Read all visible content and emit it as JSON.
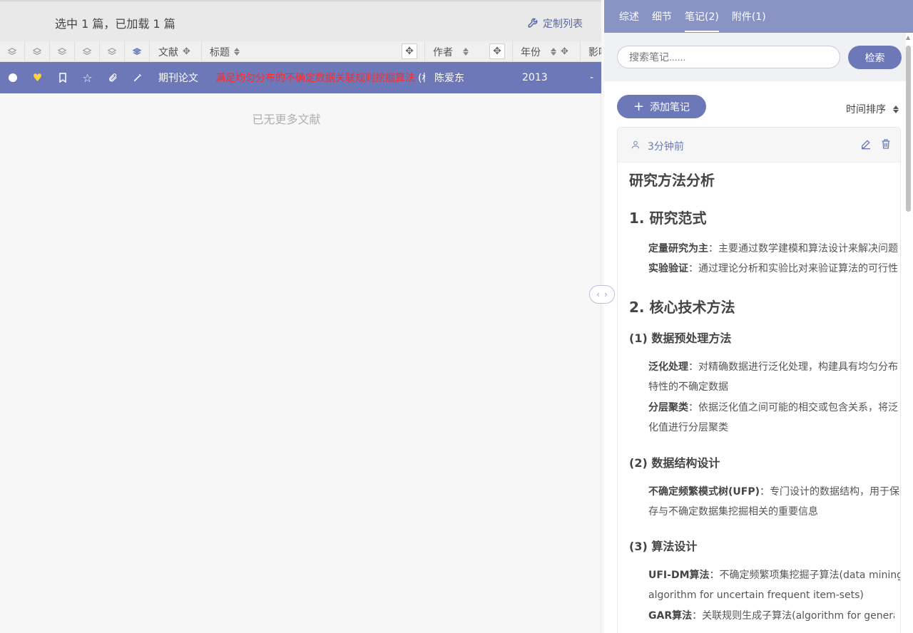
{
  "left": {
    "selection_text": "选中 1 篇，已加载 1 篇",
    "customize_label": "定制列表",
    "headers": {
      "literature": "文献",
      "title": "标题",
      "author": "作者",
      "year": "年份",
      "impact": "影响"
    },
    "row": {
      "type": "期刊论文",
      "title": "满足均匀分布的不确定数据关联规则挖掘算法",
      "title_suffix": "(标",
      "author": "陈爱东",
      "year": "2013",
      "impact": "-"
    },
    "empty_text": "已无更多文献"
  },
  "right": {
    "tabs": [
      "综述",
      "细节",
      "笔记(2)",
      "附件(1)"
    ],
    "active_tab": "笔记(2)",
    "search_placeholder": "搜索笔记......",
    "search_button": "检索",
    "add_note": "添加笔记",
    "sort_label": "时间排序",
    "note": {
      "time": "3分钟前",
      "h1": "研究方法分析",
      "s1": "1. 研究范式",
      "p1_b": "定量研究为主",
      "p1": "：主要通过数学建模和算法设计来解决问题",
      "p2_b": "实验验证",
      "p2": "：通过理论分析和实验比对来验证算法的可行性",
      "s2": "2. 核心技术方法",
      "ss1": "(1) 数据预处理方法",
      "p3_b": "泛化处理",
      "p3": "：对精确数据进行泛化处理，构建具有均匀分布",
      "p3b": "特性的不确定数据",
      "p4_b": "分层聚类",
      "p4": "：依据泛化值之间可能的相交或包含关系，将泛",
      "p4b": "化值进行分层聚类",
      "ss2": "(2) 数据结构设计",
      "p5_b": "不确定频繁模式树(UFP)",
      "p5": "：专门设计的数据结构，用于保",
      "p5b": "存与不确定数据集挖掘相关的重要信息",
      "ss3": "(3) 算法设计",
      "p6_b": "UFI-DM算法",
      "p6": "：不确定频繁项集挖掘子算法(data mining",
      "p6b": "algorithm for uncertain frequent item-sets)",
      "p7_b": "GAR算法",
      "p7": "：关联规则生成子算法(algorithm for generati"
    }
  },
  "colors": {
    "accent": "#6c78b8",
    "tab_bar": "#8a94c4",
    "title_red": "#ff2a2a"
  }
}
